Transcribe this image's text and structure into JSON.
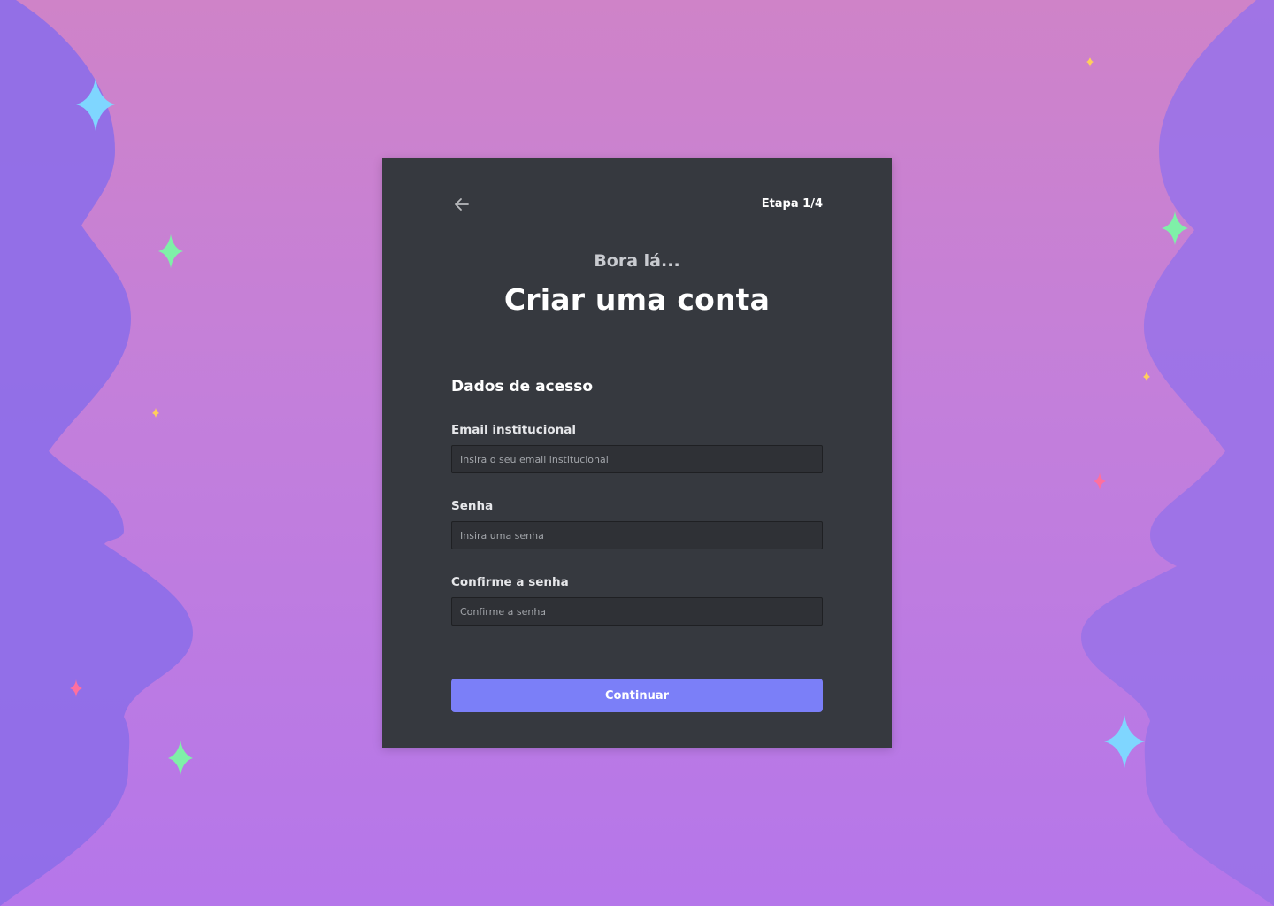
{
  "header": {
    "back_icon": "arrow-left-icon",
    "step_label": "Etapa 1/4"
  },
  "hero": {
    "eyebrow": "Bora lá...",
    "title": "Criar uma conta"
  },
  "form": {
    "section_title": "Dados de acesso",
    "email": {
      "label": "Email institucional",
      "value": "",
      "placeholder": "Insira o seu email institucional"
    },
    "password": {
      "label": "Senha",
      "value": "",
      "placeholder": "Insira uma senha"
    },
    "confirm": {
      "label": "Confirme a senha",
      "value": "",
      "placeholder": "Confirme a senha"
    },
    "submit_label": "Continuar"
  },
  "colors": {
    "card_bg": "#36393f",
    "input_bg": "#2f3136",
    "accent": "#7b7ff8",
    "sparkle_blue": "#7fd6ff",
    "sparkle_green": "#7ff0a8",
    "sparkle_pink": "#ff6f9e",
    "sparkle_yellow": "#ffcf5c"
  },
  "decorations": {
    "sparkle_icon": "sparkle-icon"
  }
}
